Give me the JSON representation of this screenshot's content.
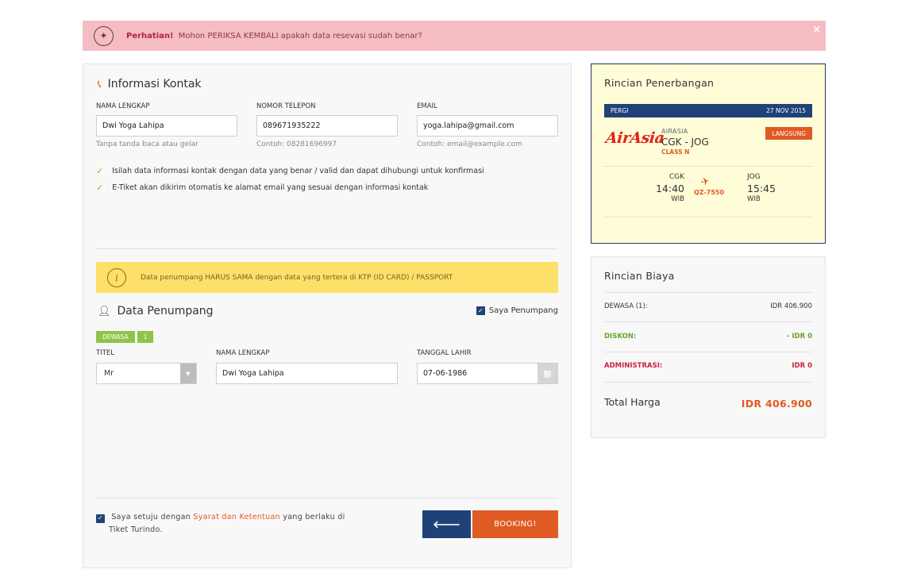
{
  "alert": {
    "strong": "Perhatian!",
    "text": "Mohon PERIKSA KEMBALI apakah data resevasi sudah benar?",
    "close": "×"
  },
  "contact": {
    "title": "Informasi Kontak",
    "name_label": "NAMA LENGKAP",
    "name_value": "Dwi Yoga Lahipa",
    "name_hint": "Tanpa tanda baca atau gelar",
    "phone_label": "NOMOR TELEPON",
    "phone_value": "089671935222",
    "phone_hint": "Contoh: 08281696997",
    "email_label": "EMAIL",
    "email_value": "yoga.lahipa@gmail.com",
    "email_hint": "Contoh: email@example.com",
    "notes": [
      "Isilah data informasi kontak dengan data yang benar / valid dan dapat dihubungi untuk konfirmasi",
      "E-Tiket akan dikirim otomatis ke alamat email yang sesuai dengan informasi kontak"
    ]
  },
  "warning": {
    "text": "Data penumpang HARUS SAMA dengan data yang tertera di KTP (ID CARD) / PASSPORT"
  },
  "passenger": {
    "title": "Data Penumpang",
    "self_label": "Saya Penumpang",
    "type_badge": "DEWASA",
    "index_badge": "1",
    "title_label": "TITEL",
    "title_value": "Mr",
    "name_label": "NAMA LENGKAP",
    "name_value": "Dwi Yoga Lahipa",
    "dob_label": "TANGGAL LAHIR",
    "dob_value": "07-06-1986"
  },
  "agreement": {
    "prefix": "Saya setuju dengan",
    "link": "Syarat dan Ketentuan",
    "suffix": "yang berlaku di",
    "line2": "Tiket Turindo."
  },
  "buttons": {
    "back": "🡐",
    "booking": "BOOKING!"
  },
  "flight": {
    "title": "Rincian Penerbangan",
    "direction": "PERGI",
    "date": "27 NOV 2015",
    "logo": "AirAsia",
    "airline": "AIRASIA",
    "route": "CGK - JOG",
    "class": "CLASS N",
    "type": "LANGSUNG",
    "from_code": "CGK",
    "from_time": "14:40",
    "from_tz": "WIB",
    "flight_no": "QZ-7550",
    "to_code": "JOG",
    "to_time": "15:45",
    "to_tz": "WIB"
  },
  "cost": {
    "title": "Rincian Biaya",
    "adult_label": "DEWASA (1):",
    "adult_value": "IDR 406.900",
    "discount_label": "DISKON:",
    "discount_value": "- IDR 0",
    "admin_label": "ADMINISTRASI:",
    "admin_value": "IDR 0",
    "total_label": "Total Harga",
    "total_value": "IDR 406.900"
  },
  "colors": {
    "accent": "#e05a24",
    "navy": "#1e4278",
    "alert_bg": "#f5bcc4",
    "warning_bg": "#fde06a",
    "success": "#7cbf3a"
  }
}
